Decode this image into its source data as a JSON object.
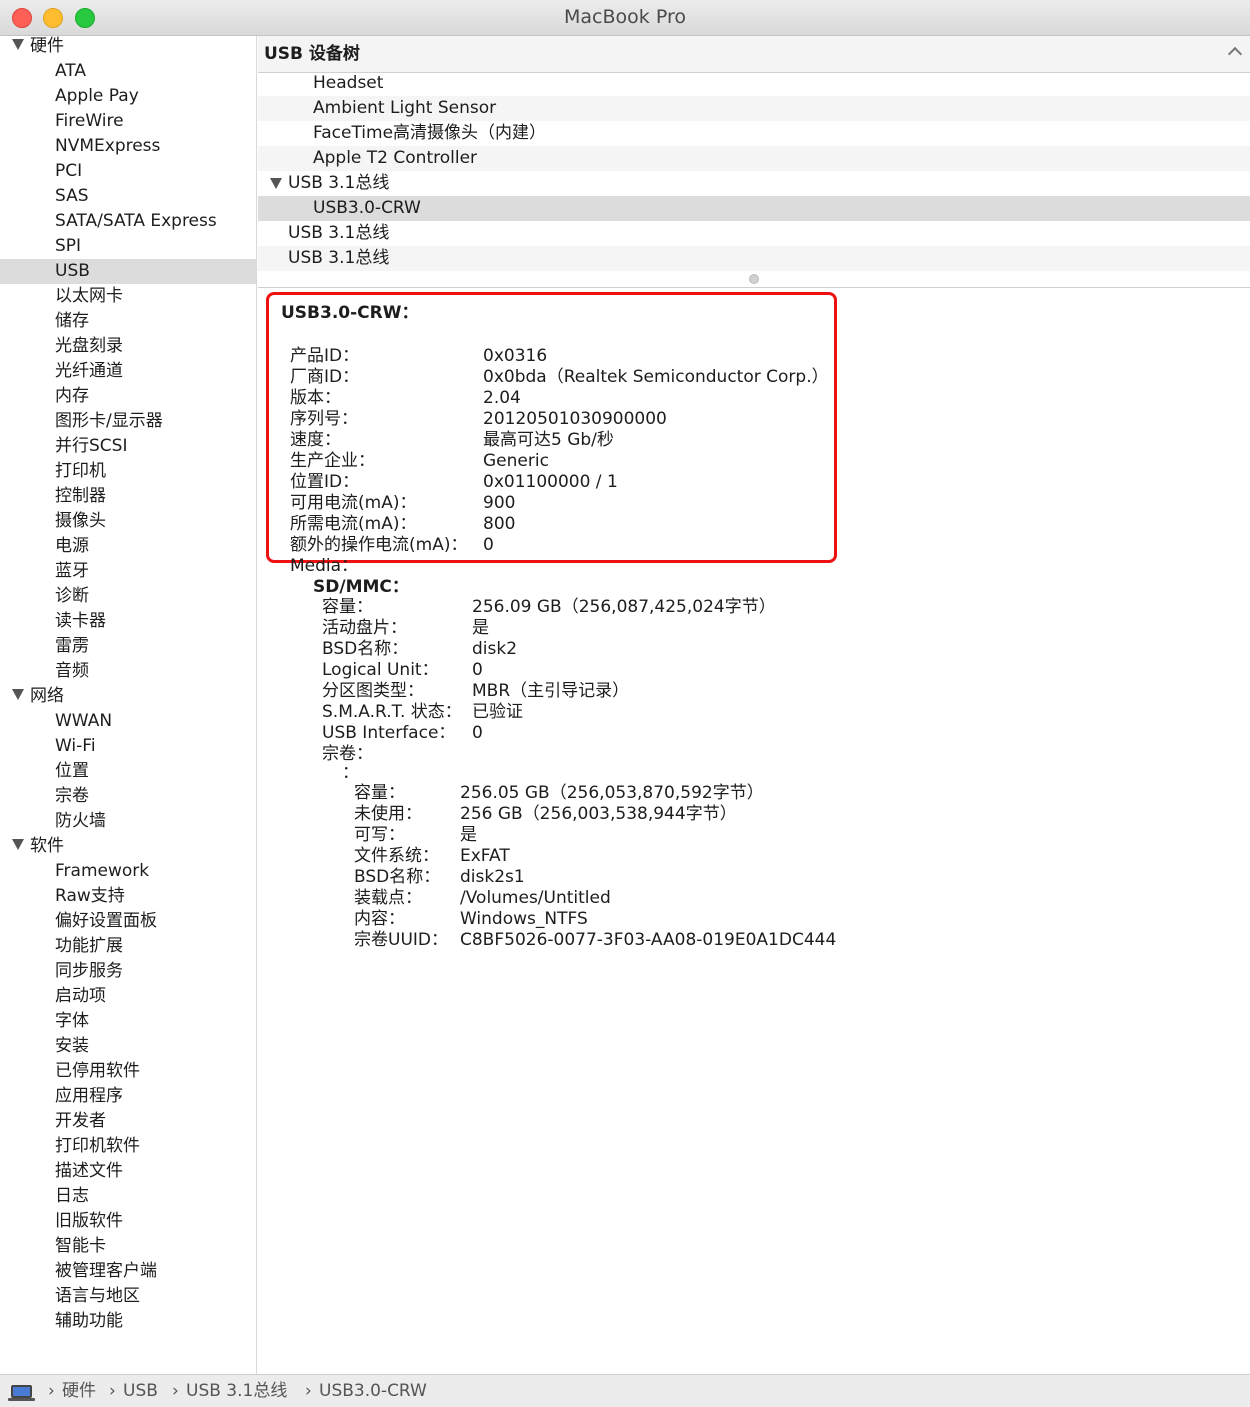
{
  "window": {
    "title": "MacBook Pro"
  },
  "sidebar": {
    "items": [
      {
        "label": "硬件",
        "type": "group"
      },
      {
        "label": "ATA",
        "type": "child"
      },
      {
        "label": "Apple Pay",
        "type": "child"
      },
      {
        "label": "FireWire",
        "type": "child"
      },
      {
        "label": "NVMExpress",
        "type": "child"
      },
      {
        "label": "PCI",
        "type": "child"
      },
      {
        "label": "SAS",
        "type": "child"
      },
      {
        "label": "SATA/SATA Express",
        "type": "child"
      },
      {
        "label": "SPI",
        "type": "child"
      },
      {
        "label": "USB",
        "type": "child",
        "selected": true
      },
      {
        "label": "以太网卡",
        "type": "child"
      },
      {
        "label": "储存",
        "type": "child"
      },
      {
        "label": "光盘刻录",
        "type": "child"
      },
      {
        "label": "光纤通道",
        "type": "child"
      },
      {
        "label": "内存",
        "type": "child"
      },
      {
        "label": "图形卡/显示器",
        "type": "child"
      },
      {
        "label": "并行SCSI",
        "type": "child"
      },
      {
        "label": "打印机",
        "type": "child"
      },
      {
        "label": "控制器",
        "type": "child"
      },
      {
        "label": "摄像头",
        "type": "child"
      },
      {
        "label": "电源",
        "type": "child"
      },
      {
        "label": "蓝牙",
        "type": "child"
      },
      {
        "label": "诊断",
        "type": "child"
      },
      {
        "label": "读卡器",
        "type": "child"
      },
      {
        "label": "雷雳",
        "type": "child"
      },
      {
        "label": "音频",
        "type": "child"
      },
      {
        "label": "网络",
        "type": "group"
      },
      {
        "label": "WWAN",
        "type": "child"
      },
      {
        "label": "Wi-Fi",
        "type": "child"
      },
      {
        "label": "位置",
        "type": "child"
      },
      {
        "label": "宗卷",
        "type": "child"
      },
      {
        "label": "防火墙",
        "type": "child"
      },
      {
        "label": "软件",
        "type": "group"
      },
      {
        "label": "Framework",
        "type": "child"
      },
      {
        "label": "Raw支持",
        "type": "child"
      },
      {
        "label": "偏好设置面板",
        "type": "child"
      },
      {
        "label": "功能扩展",
        "type": "child"
      },
      {
        "label": "同步服务",
        "type": "child"
      },
      {
        "label": "启动项",
        "type": "child"
      },
      {
        "label": "字体",
        "type": "child"
      },
      {
        "label": "安装",
        "type": "child"
      },
      {
        "label": "已停用软件",
        "type": "child"
      },
      {
        "label": "应用程序",
        "type": "child"
      },
      {
        "label": "开发者",
        "type": "child"
      },
      {
        "label": "打印机软件",
        "type": "child"
      },
      {
        "label": "描述文件",
        "type": "child"
      },
      {
        "label": "日志",
        "type": "child"
      },
      {
        "label": "旧版软件",
        "type": "child"
      },
      {
        "label": "智能卡",
        "type": "child"
      },
      {
        "label": "被管理客户端",
        "type": "child"
      },
      {
        "label": "语言与地区",
        "type": "child"
      },
      {
        "label": "辅助功能",
        "type": "child"
      }
    ]
  },
  "tree": {
    "header": "USB 设备树",
    "rows": [
      {
        "label": "Headset",
        "level": 2
      },
      {
        "label": "Ambient Light Sensor",
        "level": 2
      },
      {
        "label": "FaceTime高清摄像头（内建）",
        "level": 2
      },
      {
        "label": "Apple T2 Controller",
        "level": 2
      },
      {
        "label": "USB 3.1总线",
        "level": 1,
        "expanded": true
      },
      {
        "label": "USB3.0-CRW",
        "level": 2,
        "selected": true
      },
      {
        "label": "USB 3.1总线",
        "level": 1
      },
      {
        "label": "USB 3.1总线",
        "level": 1
      }
    ]
  },
  "detail": {
    "title": "USB3.0-CRW：",
    "props": [
      {
        "k": "产品ID：",
        "v": "0x0316"
      },
      {
        "k": "厂商ID：",
        "v": "0x0bda（Realtek Semiconductor Corp.）"
      },
      {
        "k": "版本：",
        "v": "2.04"
      },
      {
        "k": "序列号：",
        "v": "20120501030900000"
      },
      {
        "k": "速度：",
        "v": "最高可达5 Gb/秒"
      },
      {
        "k": "生产企业：",
        "v": "Generic"
      },
      {
        "k": "位置ID：",
        "v": "0x01100000 / 1"
      },
      {
        "k": "可用电流(mA)：",
        "v": "900"
      },
      {
        "k": "所需电流(mA)：",
        "v": "800"
      },
      {
        "k": "额外的操作电流(mA)：",
        "v": "0"
      }
    ],
    "media_label": "Media：",
    "sd_title": "SD/MMC：",
    "media_props": [
      {
        "k": "容量：",
        "v": "256.09 GB（256,087,425,024字节）"
      },
      {
        "k": "活动盘片：",
        "v": "是"
      },
      {
        "k": "BSD名称：",
        "v": "disk2"
      },
      {
        "k": "Logical Unit：",
        "v": "0"
      },
      {
        "k": "分区图类型：",
        "v": "MBR（主引导记录）"
      },
      {
        "k": "S.M.A.R.T. 状态：",
        "v": "已验证"
      },
      {
        "k": "USB Interface：",
        "v": "0"
      },
      {
        "k": "宗卷：",
        "v": ""
      }
    ],
    "volume_label": "：",
    "volume_props": [
      {
        "k": "容量：",
        "v": "256.05 GB（256,053,870,592字节）"
      },
      {
        "k": "未使用：",
        "v": "256 GB（256,003,538,944字节）"
      },
      {
        "k": "可写：",
        "v": "是"
      },
      {
        "k": "文件系统：",
        "v": "ExFAT"
      },
      {
        "k": "BSD名称：",
        "v": "disk2s1"
      },
      {
        "k": "装载点：",
        "v": "/Volumes/Untitled"
      },
      {
        "k": "内容：",
        "v": "Windows_NTFS"
      },
      {
        "k": "宗卷UUID：",
        "v": "C8BF5026-0077-3F03-AA08-019E0A1DC444"
      }
    ]
  },
  "breadcrumb": [
    "硬件",
    "USB",
    "USB 3.1总线",
    "USB3.0-CRW"
  ],
  "breadcrumb_sep": "›",
  "icons": {
    "status": "macbook-icon",
    "expand": "triangle-down-icon",
    "collapse": "chevron-up-icon"
  }
}
